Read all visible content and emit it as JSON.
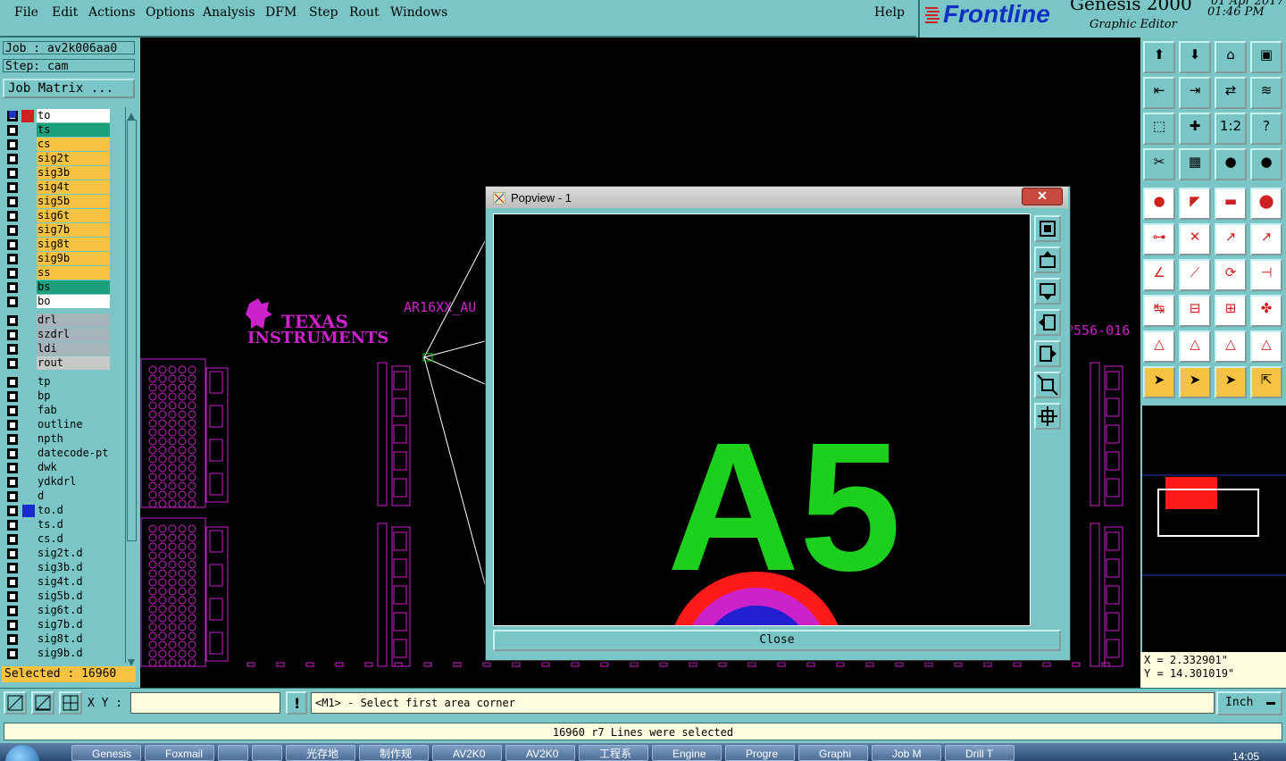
{
  "menu": [
    "File",
    "Edit",
    "Actions",
    "Options",
    "Analysis",
    "DFM",
    "Step",
    "Rout",
    "Windows"
  ],
  "help": "Help",
  "brand": {
    "logo": "Frontline",
    "product": "Genesis 2000",
    "subtitle": "Graphic Editor",
    "date": "01 Apr 2017",
    "time": "01:46 PM"
  },
  "job": {
    "job": "Job : av2k006aa0",
    "step": "Step: cam",
    "matrix": "Job Matrix ..."
  },
  "layers": [
    {
      "name": "to",
      "color": "#ffffff"
    },
    {
      "name": "ts",
      "color": "#1aa07a"
    },
    {
      "name": "cs",
      "color": "#f5c242"
    },
    {
      "name": "sig2t",
      "color": "#f5c242"
    },
    {
      "name": "sig3b",
      "color": "#f5c242"
    },
    {
      "name": "sig4t",
      "color": "#f5c242"
    },
    {
      "name": "sig5b",
      "color": "#f5c242"
    },
    {
      "name": "sig6t",
      "color": "#f5c242"
    },
    {
      "name": "sig7b",
      "color": "#f5c242"
    },
    {
      "name": "sig8t",
      "color": "#f5c242"
    },
    {
      "name": "sig9b",
      "color": "#f5c242"
    },
    {
      "name": "ss",
      "color": "#f5c242"
    },
    {
      "name": "bs",
      "color": "#1aa07a"
    },
    {
      "name": "bo",
      "color": "#ffffff"
    },
    {
      "name": "drl",
      "color": "#a8b4bc"
    },
    {
      "name": "szdrl",
      "color": "#a8b4bc"
    },
    {
      "name": "ldi",
      "color": "#a8b4bc"
    },
    {
      "name": "rout",
      "color": "#c8c8c8"
    },
    {
      "name": "tp",
      "color": "#7ac6c6"
    },
    {
      "name": "bp",
      "color": "#7ac6c6"
    },
    {
      "name": "fab",
      "color": "#7ac6c6"
    },
    {
      "name": "outline",
      "color": "#7ac6c6"
    },
    {
      "name": "npth",
      "color": "#7ac6c6"
    },
    {
      "name": "datecode-pt",
      "color": "#7ac6c6"
    },
    {
      "name": "dwk",
      "color": "#7ac6c6"
    },
    {
      "name": "ydkdrl",
      "color": "#7ac6c6"
    },
    {
      "name": "d",
      "color": "#7ac6c6"
    },
    {
      "name": "to.d",
      "color": "#7ac6c6"
    },
    {
      "name": "ts.d",
      "color": "#7ac6c6"
    },
    {
      "name": "cs.d",
      "color": "#7ac6c6"
    },
    {
      "name": "sig2t.d",
      "color": "#7ac6c6"
    },
    {
      "name": "sig3b.d",
      "color": "#7ac6c6"
    },
    {
      "name": "sig4t.d",
      "color": "#7ac6c6"
    },
    {
      "name": "sig5b.d",
      "color": "#7ac6c6"
    },
    {
      "name": "sig6t.d",
      "color": "#7ac6c6"
    },
    {
      "name": "sig7b.d",
      "color": "#7ac6c6"
    },
    {
      "name": "sig8t.d",
      "color": "#7ac6c6"
    },
    {
      "name": "sig9b.d",
      "color": "#7ac6c6"
    }
  ],
  "selected": "Selected : 16960",
  "canvas": {
    "logo_line1": "TEXAS",
    "logo_line2": "INSTRUMENTS",
    "label_left": "AR16XX_AU",
    "label_right": "P556-016"
  },
  "popup": {
    "title": "Popview - 1",
    "close_x": "✕",
    "magnified_text": "A5",
    "close_button": "Close"
  },
  "coords": {
    "x": "X = 2.332901\"",
    "y": "Y = 14.301019\""
  },
  "command": {
    "xy_label": "X Y :",
    "xy_value": "",
    "prompt": "<M1> - Select first area corner",
    "unit": "Inch"
  },
  "status": "16960 r7 Lines were selected",
  "taskbar": [
    "Genesis",
    "Foxmail",
    "",
    "",
    "光存地",
    "制作规",
    "AV2K0",
    "AV2K0",
    "工程系",
    "Engine",
    "Progre",
    "Graphi",
    "Job M",
    "Drill T"
  ],
  "clock": "14:05",
  "colors": {
    "bg": "#7ac6c6",
    "canvas": "#000000",
    "magenta": "#cc22cc",
    "green": "#1ed01e",
    "highlight": "#f5c242"
  }
}
